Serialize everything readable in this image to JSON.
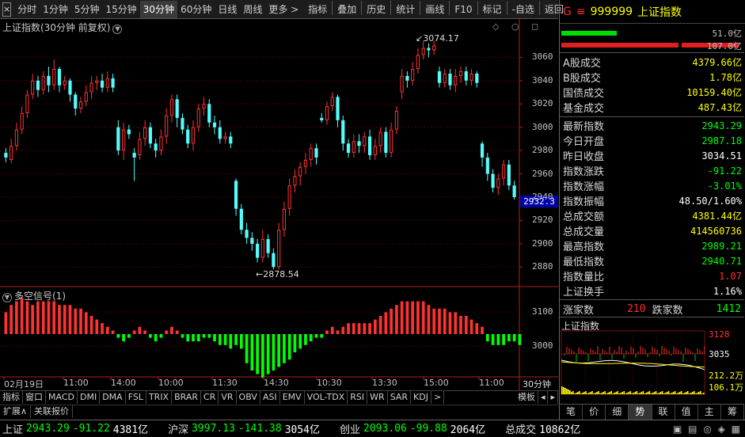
{
  "toolbar": {
    "close_glyph": "×",
    "periods": [
      "分时",
      "1分钟",
      "5分钟",
      "15分钟",
      "30分钟",
      "60分钟",
      "日线",
      "周线",
      "更多 >"
    ],
    "active_period": "30分钟",
    "tools": [
      "指标",
      "叠加",
      "历史",
      "统计",
      "画线",
      "F10",
      "标记",
      "-自选",
      "返回"
    ]
  },
  "main_chart": {
    "title": "上证指数(30分钟 前复权)",
    "title_icon": "▼",
    "controls": "◇ ○ ◻",
    "current_price": "2932.3",
    "high_annotation": "3074.17",
    "low_annotation": "2878.54",
    "period_badge": "30分钟",
    "colors": {
      "up": "#ff3232",
      "down": "#54fcfc",
      "grid": "#8b0000",
      "price_tag": "#0000a8"
    }
  },
  "sub_chart": {
    "title": "多空信号(1)",
    "title_icon": "▼",
    "colors": {
      "up": "#ff3232",
      "down": "#00ff00"
    }
  },
  "indicator_tabs": [
    "指标",
    "窗口",
    "MACD",
    "DMI",
    "DMA",
    "FSL",
    "TRIX",
    "BRAR",
    "CR",
    "VR",
    "OBV",
    "ASI",
    "EMV",
    "VOL-TDX",
    "RSI",
    "WR",
    "SAR",
    "KDJ",
    ">",
    "模板",
    "◂",
    "▸"
  ],
  "ext_tabs": [
    "扩展∧",
    "关联报价"
  ],
  "chart_data": {
    "type": "candlestick",
    "title": "上证指数(30分钟 前复权)",
    "x_tick_labels": [
      "02月19日",
      "11:00",
      "14:00",
      "10:00",
      "11:30",
      "14:30",
      "10:30",
      "13:30",
      "15:00",
      "11:00"
    ],
    "y_tick_labels": [
      3060,
      3040,
      3020,
      3000,
      2980,
      2960,
      2940,
      2920,
      2900,
      2880
    ],
    "ylim": [
      2868,
      3082
    ],
    "candles": [
      {
        "o": 2978,
        "c": 2974,
        "h": 2982,
        "l": 2970
      },
      {
        "o": 2972,
        "c": 2984,
        "h": 2990,
        "l": 2969
      },
      {
        "o": 2984,
        "c": 2998,
        "h": 3004,
        "l": 2980
      },
      {
        "o": 2998,
        "c": 3012,
        "h": 3018,
        "l": 2994
      },
      {
        "o": 3012,
        "c": 3028,
        "h": 3032,
        "l": 3008
      },
      {
        "o": 3028,
        "c": 3040,
        "h": 3046,
        "l": 3024
      },
      {
        "o": 3040,
        "c": 3032,
        "h": 3044,
        "l": 3026
      },
      {
        "o": 3032,
        "c": 3044,
        "h": 3048,
        "l": 3028
      },
      {
        "o": 3044,
        "c": 3036,
        "h": 3052,
        "l": 3030
      },
      {
        "o": 3036,
        "c": 3050,
        "h": 3058,
        "l": 3032
      },
      {
        "o": 3050,
        "c": 3036,
        "h": 3052,
        "l": 3030
      },
      {
        "o": 3036,
        "c": 3040,
        "h": 3044,
        "l": 3032
      },
      {
        "o": 3040,
        "c": 3028,
        "h": 3042,
        "l": 3022
      },
      {
        "o": 3028,
        "c": 3016,
        "h": 3030,
        "l": 3010
      },
      {
        "o": 3016,
        "c": 3022,
        "h": 3026,
        "l": 3012
      },
      {
        "o": 3022,
        "c": 3030,
        "h": 3036,
        "l": 3018
      },
      {
        "o": 3030,
        "c": 3038,
        "h": 3044,
        "l": 3024
      },
      {
        "o": 3038,
        "c": 3040,
        "h": 3044,
        "l": 3032
      },
      {
        "o": 3040,
        "c": 3034,
        "h": 3046,
        "l": 3030
      },
      {
        "o": 3034,
        "c": 3042,
        "h": 3048,
        "l": 3030
      },
      {
        "o": 3042,
        "c": 3034,
        "h": 3046,
        "l": 3030
      },
      {
        "o": 3000,
        "c": 2980,
        "h": 3006,
        "l": 2976
      },
      {
        "o": 2980,
        "c": 2998,
        "h": 3004,
        "l": 2972
      },
      {
        "o": 2998,
        "c": 2994,
        "h": 3002,
        "l": 2990
      },
      {
        "o": 2978,
        "c": 2974,
        "h": 2982,
        "l": 2954
      },
      {
        "o": 2976,
        "c": 2990,
        "h": 2996,
        "l": 2972
      },
      {
        "o": 2990,
        "c": 3000,
        "h": 3006,
        "l": 2984
      },
      {
        "o": 3000,
        "c": 2986,
        "h": 3004,
        "l": 2982
      },
      {
        "o": 2986,
        "c": 2980,
        "h": 2990,
        "l": 2974
      },
      {
        "o": 2980,
        "c": 2992,
        "h": 2998,
        "l": 2976
      },
      {
        "o": 2992,
        "c": 3010,
        "h": 3016,
        "l": 2986
      },
      {
        "o": 3010,
        "c": 3024,
        "h": 3028,
        "l": 3004
      },
      {
        "o": 3024,
        "c": 3008,
        "h": 3028,
        "l": 3000
      },
      {
        "o": 3008,
        "c": 2998,
        "h": 3012,
        "l": 2994
      },
      {
        "o": 2998,
        "c": 2986,
        "h": 3002,
        "l": 2982
      },
      {
        "o": 2986,
        "c": 3000,
        "h": 3006,
        "l": 2980
      },
      {
        "o": 3000,
        "c": 3016,
        "h": 3020,
        "l": 2996
      },
      {
        "o": 3016,
        "c": 3020,
        "h": 3026,
        "l": 3010
      },
      {
        "o": 3020,
        "c": 3004,
        "h": 3024,
        "l": 3000
      },
      {
        "o": 3004,
        "c": 3000,
        "h": 3010,
        "l": 2994
      },
      {
        "o": 3000,
        "c": 2990,
        "h": 3006,
        "l": 2986
      },
      {
        "o": 2990,
        "c": 2992,
        "h": 2996,
        "l": 2986
      },
      {
        "o": 2992,
        "c": 2986,
        "h": 2996,
        "l": 2982
      },
      {
        "o": 2954,
        "c": 2930,
        "h": 2956,
        "l": 2924
      },
      {
        "o": 2930,
        "c": 2912,
        "h": 2934,
        "l": 2908
      },
      {
        "o": 2912,
        "c": 2905,
        "h": 2918,
        "l": 2900
      },
      {
        "o": 2905,
        "c": 2900,
        "h": 2910,
        "l": 2894
      },
      {
        "o": 2900,
        "c": 2888,
        "h": 2904,
        "l": 2884
      },
      {
        "o": 2888,
        "c": 2904,
        "h": 2912,
        "l": 2884
      },
      {
        "o": 2904,
        "c": 2892,
        "h": 2908,
        "l": 2888
      },
      {
        "o": 2892,
        "c": 2880,
        "h": 2896,
        "l": 2878
      },
      {
        "o": 2880,
        "c": 2912,
        "h": 2918,
        "l": 2878
      },
      {
        "o": 2912,
        "c": 2930,
        "h": 2936,
        "l": 2906
      },
      {
        "o": 2930,
        "c": 2950,
        "h": 2956,
        "l": 2924
      },
      {
        "o": 2950,
        "c": 2958,
        "h": 2964,
        "l": 2944
      },
      {
        "o": 2958,
        "c": 2966,
        "h": 2970,
        "l": 2950
      },
      {
        "o": 2966,
        "c": 2972,
        "h": 2978,
        "l": 2960
      },
      {
        "o": 2972,
        "c": 2982,
        "h": 2986,
        "l": 2966
      },
      {
        "o": 2982,
        "c": 2974,
        "h": 2986,
        "l": 2968
      },
      {
        "o": 3008,
        "c": 3006,
        "h": 3012,
        "l": 3004
      },
      {
        "o": 3006,
        "c": 3018,
        "h": 3022,
        "l": 3002
      },
      {
        "o": 3018,
        "c": 3026,
        "h": 3030,
        "l": 3014
      },
      {
        "o": 3026,
        "c": 3006,
        "h": 3028,
        "l": 3000
      },
      {
        "o": 3006,
        "c": 2986,
        "h": 3010,
        "l": 2980
      },
      {
        "o": 2986,
        "c": 2978,
        "h": 2990,
        "l": 2974
      },
      {
        "o": 2978,
        "c": 2988,
        "h": 2994,
        "l": 2974
      },
      {
        "o": 2988,
        "c": 2984,
        "h": 2994,
        "l": 2978
      },
      {
        "o": 2984,
        "c": 2992,
        "h": 2996,
        "l": 2978
      },
      {
        "o": 2992,
        "c": 2976,
        "h": 2998,
        "l": 2972
      },
      {
        "o": 2976,
        "c": 2984,
        "h": 2990,
        "l": 2972
      },
      {
        "o": 2984,
        "c": 2996,
        "h": 3000,
        "l": 2978
      },
      {
        "o": 2996,
        "c": 2978,
        "h": 3000,
        "l": 2974
      },
      {
        "o": 2978,
        "c": 2998,
        "h": 3004,
        "l": 2974
      },
      {
        "o": 2998,
        "c": 3014,
        "h": 3018,
        "l": 2994
      },
      {
        "o": 3030,
        "c": 3044,
        "h": 3050,
        "l": 3024
      },
      {
        "o": 3044,
        "c": 3040,
        "h": 3048,
        "l": 3034
      },
      {
        "o": 3040,
        "c": 3050,
        "h": 3056,
        "l": 3036
      },
      {
        "o": 3050,
        "c": 3062,
        "h": 3068,
        "l": 3046
      },
      {
        "o": 3062,
        "c": 3068,
        "h": 3074,
        "l": 3058
      },
      {
        "o": 3068,
        "c": 3066,
        "h": 3072,
        "l": 3060
      },
      {
        "o": 3066,
        "c": 3070,
        "h": 3074,
        "l": 3062
      },
      {
        "o": 3048,
        "c": 3038,
        "h": 3052,
        "l": 3034
      },
      {
        "o": 3038,
        "c": 3046,
        "h": 3050,
        "l": 3034
      },
      {
        "o": 3046,
        "c": 3036,
        "h": 3050,
        "l": 3032
      },
      {
        "o": 3036,
        "c": 3044,
        "h": 3050,
        "l": 3030
      },
      {
        "o": 3044,
        "c": 3048,
        "h": 3052,
        "l": 3038
      },
      {
        "o": 3048,
        "c": 3040,
        "h": 3052,
        "l": 3036
      },
      {
        "o": 3040,
        "c": 3046,
        "h": 3050,
        "l": 3036
      },
      {
        "o": 3046,
        "c": 3038,
        "h": 3048,
        "l": 3034
      },
      {
        "o": 2986,
        "c": 2974,
        "h": 2988,
        "l": 2966
      },
      {
        "o": 2974,
        "c": 2960,
        "h": 2978,
        "l": 2954
      },
      {
        "o": 2960,
        "c": 2948,
        "h": 2964,
        "l": 2944
      },
      {
        "o": 2948,
        "c": 2956,
        "h": 2960,
        "l": 2942
      },
      {
        "o": 2956,
        "c": 2968,
        "h": 2972,
        "l": 2950
      },
      {
        "o": 2968,
        "c": 2950,
        "h": 2972,
        "l": 2946
      },
      {
        "o": 2950,
        "c": 2940,
        "h": 2954,
        "l": 2938
      }
    ],
    "signal_values": [
      6,
      8,
      9,
      10,
      9,
      8,
      9,
      9,
      9,
      9,
      8,
      8,
      8,
      7,
      7,
      6,
      5,
      4,
      3,
      2,
      1,
      -1,
      -2,
      -1,
      1,
      2,
      1,
      -1,
      -2,
      -1,
      1,
      2,
      1,
      -1,
      -2,
      -2,
      -2,
      -1,
      -1,
      -2,
      -3,
      -3,
      -4,
      -3,
      -4,
      -8,
      -10,
      -11,
      -12,
      -11,
      -10,
      -9,
      -8,
      -7,
      -5,
      -4,
      -3,
      -2,
      -1,
      -1,
      1,
      2,
      1,
      2,
      3,
      3,
      3,
      3,
      3,
      4,
      5,
      6,
      7,
      8,
      9,
      9,
      9,
      9,
      9,
      8,
      7,
      7,
      7,
      6,
      6,
      5,
      5,
      4,
      3,
      2,
      -2,
      -3,
      -3,
      -3,
      -2,
      -2,
      -3
    ]
  },
  "right_panel": {
    "head": {
      "flag": "G",
      "flag_glyph": "≡",
      "code": "999999",
      "name": "上证指数"
    },
    "vol_bars": {
      "green_value": "51.0亿",
      "red_value": "107.0亿"
    },
    "turnover_rows": [
      {
        "label": "A股成交",
        "value": "4379.66亿",
        "color": "#ffff00"
      },
      {
        "label": "B股成交",
        "value": "1.78亿",
        "color": "#ffff00"
      },
      {
        "label": "国债成交",
        "value": "10159.40亿",
        "color": "#ffff00"
      },
      {
        "label": "基金成交",
        "value": "487.43亿",
        "color": "#ffff00"
      }
    ],
    "quote_rows": [
      {
        "label": "最新指数",
        "value": "2943.29",
        "color": "#00ff00"
      },
      {
        "label": "今日开盘",
        "value": "2987.18",
        "color": "#00ff00"
      },
      {
        "label": "昨日收盘",
        "value": "3034.51",
        "color": "#ffffff"
      },
      {
        "label": "指数涨跌",
        "value": "-91.22",
        "color": "#00ff00"
      },
      {
        "label": "指数涨幅",
        "value": "-3.01%",
        "color": "#00ff00"
      },
      {
        "label": "指数振幅",
        "value": "48.50/1.60%",
        "color": "#ffffff"
      },
      {
        "label": "总成交额",
        "value": "4381.44亿",
        "color": "#ffff00"
      },
      {
        "label": "总成交量",
        "value": "414560736",
        "color": "#ffff00"
      },
      {
        "label": "最高指数",
        "value": "2989.21",
        "color": "#00ff00"
      },
      {
        "label": "最低指数",
        "value": "2940.71",
        "color": "#00ff00"
      },
      {
        "label": "指数量比",
        "value": "1.07",
        "color": "#ff3030"
      },
      {
        "label": "上证换手",
        "value": "1.16%",
        "color": "#ffffff"
      }
    ],
    "updown": {
      "up_label": "涨家数",
      "up_value": "210",
      "down_label": "跌家数",
      "down_value": "1412"
    },
    "mini_chart": {
      "title": "上证指数",
      "labels": [
        {
          "text": "3128",
          "color": "#ff3030"
        },
        {
          "text": "3035",
          "color": "#ffffff"
        },
        {
          "text": "212.2万",
          "color": "#ffff00"
        },
        {
          "text": "106.1万",
          "color": "#ffff00"
        }
      ]
    },
    "tabs": [
      "笔",
      "价",
      "细",
      "势",
      "联",
      "值",
      "主",
      "筹"
    ],
    "active_tab": "势"
  },
  "status_bar": {
    "items": [
      {
        "name": "上证",
        "price": "2943.29",
        "change": "-91.22",
        "volume": "4381亿"
      },
      {
        "name": "沪深",
        "price": "3997.13",
        "change": "-141.38",
        "volume": "3054亿"
      },
      {
        "name": "创业",
        "price": "2093.06",
        "change": "-99.88",
        "volume": "2064亿"
      }
    ],
    "total_label": "总成交",
    "total_value": "10862亿",
    "tray_icons": "▣ ▤ ◎ ◈ ▦"
  }
}
